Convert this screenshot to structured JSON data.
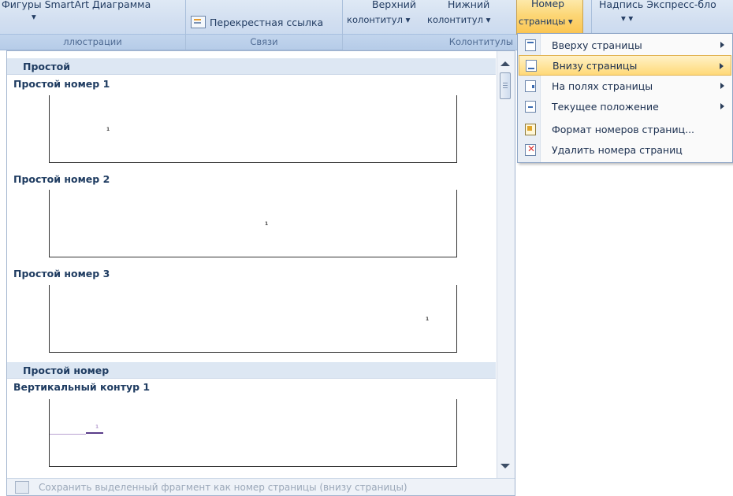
{
  "ribbon": {
    "illustrations_group_label": "ллюстрации",
    "illustrations_top_text": "Фигуры SmartArt Диаграмма",
    "links_group_label": "Связи",
    "crossref_label": "Перекрестная ссылка",
    "headers_group_label": "Колонтитулы",
    "header_top": "Верхний",
    "footer_top": "Нижний",
    "header_bottom": "колонтитул ▾",
    "footer_bottom": "колонтитул ▾",
    "pagenum_top": "Номер",
    "pagenum_bottom": "страницы ▾",
    "textbox_top": "Надпись Экспресс-бло",
    "textbox_arrows": "▾                ▾"
  },
  "gallery": {
    "section1": "Простой",
    "items": [
      {
        "title": "Простой номер 1",
        "number": "1"
      },
      {
        "title": "Простой номер 2",
        "number": "1"
      },
      {
        "title": "Простой номер 3",
        "number": "1"
      }
    ],
    "section2": "Простой номер",
    "vertical_item": {
      "title": "Вертикальный контур 1",
      "number": "1"
    },
    "footer_text": "Сохранить выделенный фрагмент как номер страницы (внизу страницы)"
  },
  "menu": {
    "items": [
      {
        "label": "Вверху страницы",
        "icon": "page-top-icon",
        "submenu": true,
        "highlighted": false
      },
      {
        "label": "Внизу страницы",
        "icon": "page-bottom-icon",
        "submenu": true,
        "highlighted": true
      },
      {
        "label": "На полях страницы",
        "icon": "page-margin-icon",
        "submenu": true,
        "highlighted": false
      },
      {
        "label": "Текущее положение",
        "icon": "current-position-icon",
        "submenu": true,
        "highlighted": false
      },
      {
        "label": "Формат номеров страниц...",
        "icon": "format-icon",
        "submenu": false,
        "highlighted": false
      },
      {
        "label": "Удалить номера страниц",
        "icon": "delete-icon",
        "submenu": false,
        "highlighted": false
      }
    ]
  },
  "colors": {
    "highlight": "#ffd978",
    "ribbon": "#d1def0",
    "section_header": "#dde7f3"
  }
}
